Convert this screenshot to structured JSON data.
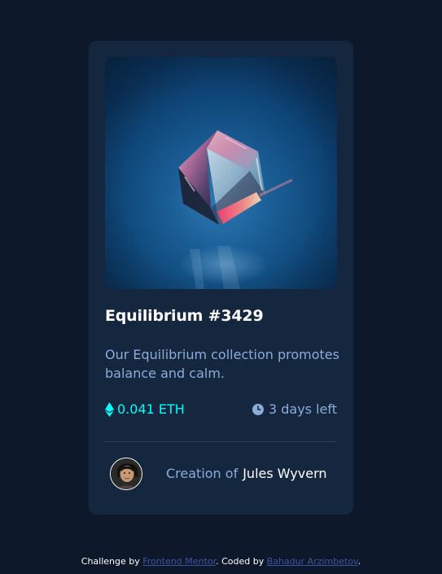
{
  "card": {
    "image_alt": "Equilibrium NFT cube image",
    "title": "Equilibrium #3429",
    "description": "Our Equilibrium collection promotes balance and calm.",
    "price": "0.041 ETH",
    "time_left": "3 days left",
    "creator_prefix": "Creation of",
    "creator_name": "Jules Wyvern"
  },
  "footer": {
    "challenge_prefix": "Challenge by",
    "challenge_link": "Frontend Mentor",
    "coded_prefix": ". Coded by",
    "coded_link": "Bahadur Arzimbetov",
    "end": "."
  },
  "colors": {
    "page_background": "#0d192b",
    "card_background": "#15263f",
    "accent_cyan": "#00fff8",
    "soft_blue": "#8bacd9",
    "white": "#ffffff",
    "link_blue": "#3e52a3",
    "divider": "#2e405a"
  },
  "icons": {
    "price_icon": "ethereum-icon",
    "time_icon": "clock-icon"
  }
}
